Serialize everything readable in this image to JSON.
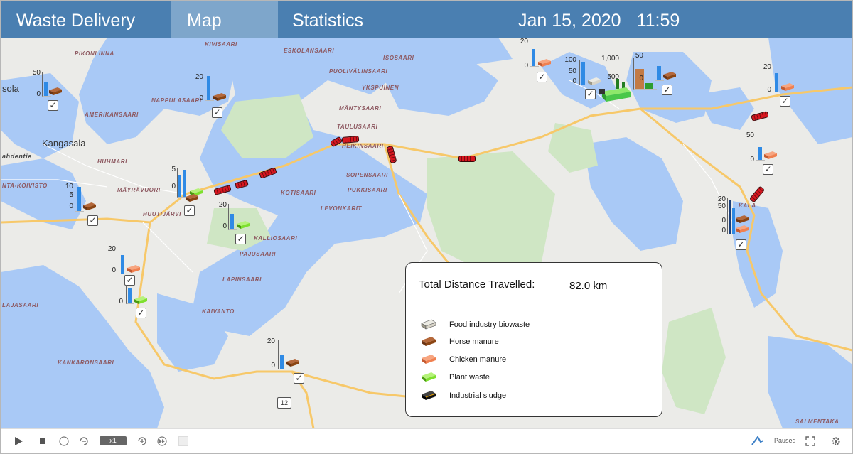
{
  "header": {
    "tabs": [
      {
        "label": "Waste Delivery"
      },
      {
        "label": "Map"
      },
      {
        "label": "Statistics"
      }
    ],
    "date": "Jan 15, 2020",
    "time": "11:59"
  },
  "map": {
    "places": [
      "PIKONLINNA",
      "KIVISAARI",
      "ESKOLANSAARI",
      "ISOSAARI",
      "PUOLIVÄLINSAARI",
      "YKSPUINEN",
      "MÄNTYSAARI",
      "sola",
      "NAPPULASAARI",
      "AMERIKANSAARI",
      "TAULUSAARI",
      "HEIKINSAARI",
      "Kangasala",
      "HUHMARI",
      "ahdentie",
      "NTA-KOIVISTO",
      "MÄYRÄVUORI",
      "HUUTIJÄRVI",
      "KOTISAARI",
      "PUKKISAARI",
      "SOPENSAARI",
      "LEVONKARIT",
      "KALLIOSAARI",
      "PAJUSAARI",
      "LAPINSAARI",
      "KAIVANTO",
      "LAJASAARI",
      "KANKARONSAARI",
      "SALMENTAKA",
      "KALA"
    ],
    "road_number": "12",
    "chart_ticks": {
      "t20": "20",
      "t0": "0",
      "t50": "50",
      "t10": "10",
      "t5": "5",
      "t100": "100",
      "t1000": "1,000",
      "t500": "500"
    }
  },
  "info_panel": {
    "distance_label": "Total Distance Travelled:",
    "distance_value": "82.0 km",
    "legend": [
      {
        "label": "Food industry biowaste",
        "color": "#d8d4c8"
      },
      {
        "label": "Horse manure",
        "color": "#8b4513"
      },
      {
        "label": "Chicken manure",
        "color": "#f08050"
      },
      {
        "label": "Plant waste",
        "color": "#7ee02e"
      },
      {
        "label": "Industrial  sludge",
        "color": "#111111"
      }
    ]
  },
  "controls": {
    "speed": "x1",
    "slow_label": "x1",
    "status": "Paused"
  }
}
